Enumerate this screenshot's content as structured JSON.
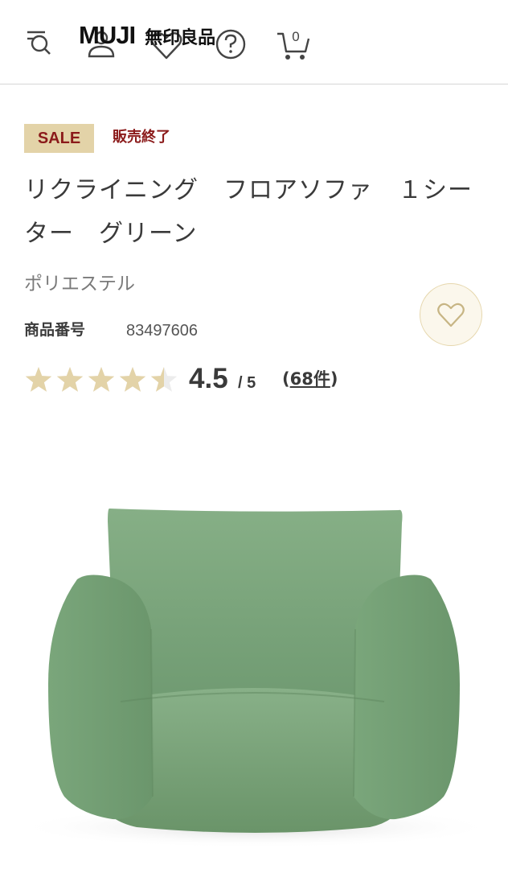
{
  "header": {
    "logo_latin": "MUJI",
    "logo_kanji": "無印良品",
    "cart_count": "0",
    "icons": [
      "search-menu-icon",
      "user-icon",
      "heart-icon",
      "help-icon",
      "cart-icon"
    ]
  },
  "product": {
    "badge": "SALE",
    "status": "販売終了",
    "title": "リクライニング　フロアソファ　１シーター　グリーン",
    "material": "ポリエステル",
    "product_number_label": "商品番号",
    "product_number": "83497606",
    "rating": {
      "score": 4.5,
      "value_text": "4.5",
      "max_text": "/ 5",
      "count_open": "(",
      "count_link": "68件",
      "count_close": ")"
    },
    "image_label": "green floor sofa"
  },
  "colors": {
    "sale_badge_bg": "#e3d3a8",
    "sale_text": "#8b1a1a",
    "star": "#e3d3a8",
    "sofa": "#7ea87f"
  }
}
